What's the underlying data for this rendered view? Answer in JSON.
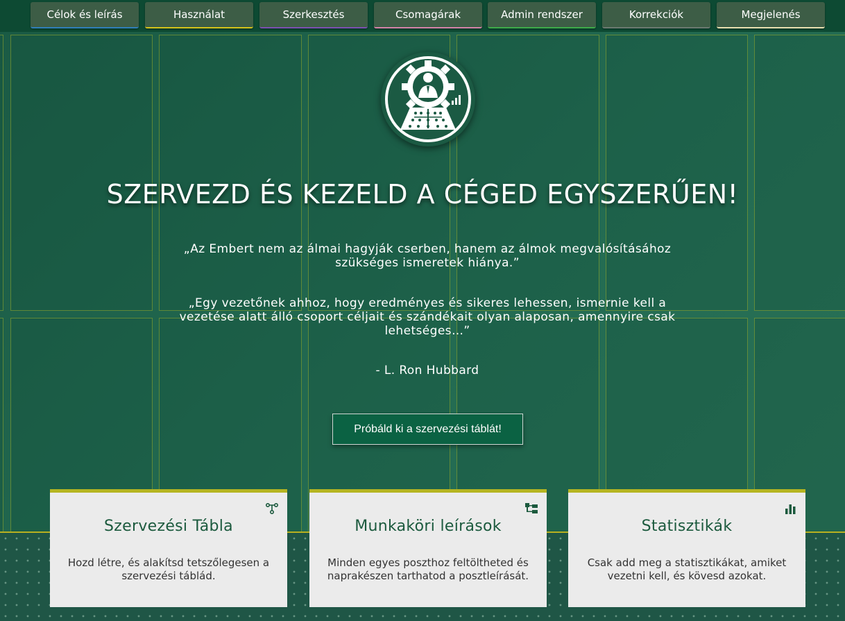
{
  "nav": {
    "items": [
      {
        "label": "Célok és leírás",
        "accent": "#2f7fb8"
      },
      {
        "label": "Használat",
        "accent": "#d4c21a"
      },
      {
        "label": "Szerkesztés",
        "accent": "#7b4fb0"
      },
      {
        "label": "Csomagárak",
        "accent": "#d483a8"
      },
      {
        "label": "Admin rendszer",
        "accent": "#3daa4a"
      },
      {
        "label": "Korrekciók",
        "accent": "#6b7a70"
      },
      {
        "label": "Megjelenés",
        "accent": "#e8e0b0"
      }
    ]
  },
  "hero": {
    "logo_icon": "org-management-logo-icon",
    "headline": "SZERVEZD ÉS KEZELD A CÉGED EGYSZERŰEN!",
    "quote1": "„Az Embert nem az álmai hagyják cserben, hanem az álmok megvalósításához szükséges ismeretek hiánya.”",
    "quote2": "„Egy vezetőnek ahhoz, hogy eredményes és sikeres lehessen, ismernie kell a vezetése alatt álló csoport céljait és szándékait olyan alaposan, amennyire csak lehetséges…”",
    "author": "- L. Ron Hubbard",
    "cta_label": "Próbáld ki a szervezési táblát!"
  },
  "cards": [
    {
      "icon": "org-chart-icon",
      "title": "Szervezési Tábla",
      "text": "Hozd létre, és alakítsd tetszőlegesen a szervezési táblád."
    },
    {
      "icon": "sitemap-icon",
      "title": "Munkaköri leírások",
      "text": "Minden egyes poszthoz feltöltheted és naprakészen tarthatod a posztleírását."
    },
    {
      "icon": "bar-chart-icon",
      "title": "Statisztikák",
      "text": "Csak add meg a statisztikákat, amiket vezetni kell, és kövesd azokat."
    }
  ],
  "colors": {
    "card_accent": "#b5b521",
    "title_green": "#1c5a3e",
    "cta_bg": "#0b6243"
  }
}
